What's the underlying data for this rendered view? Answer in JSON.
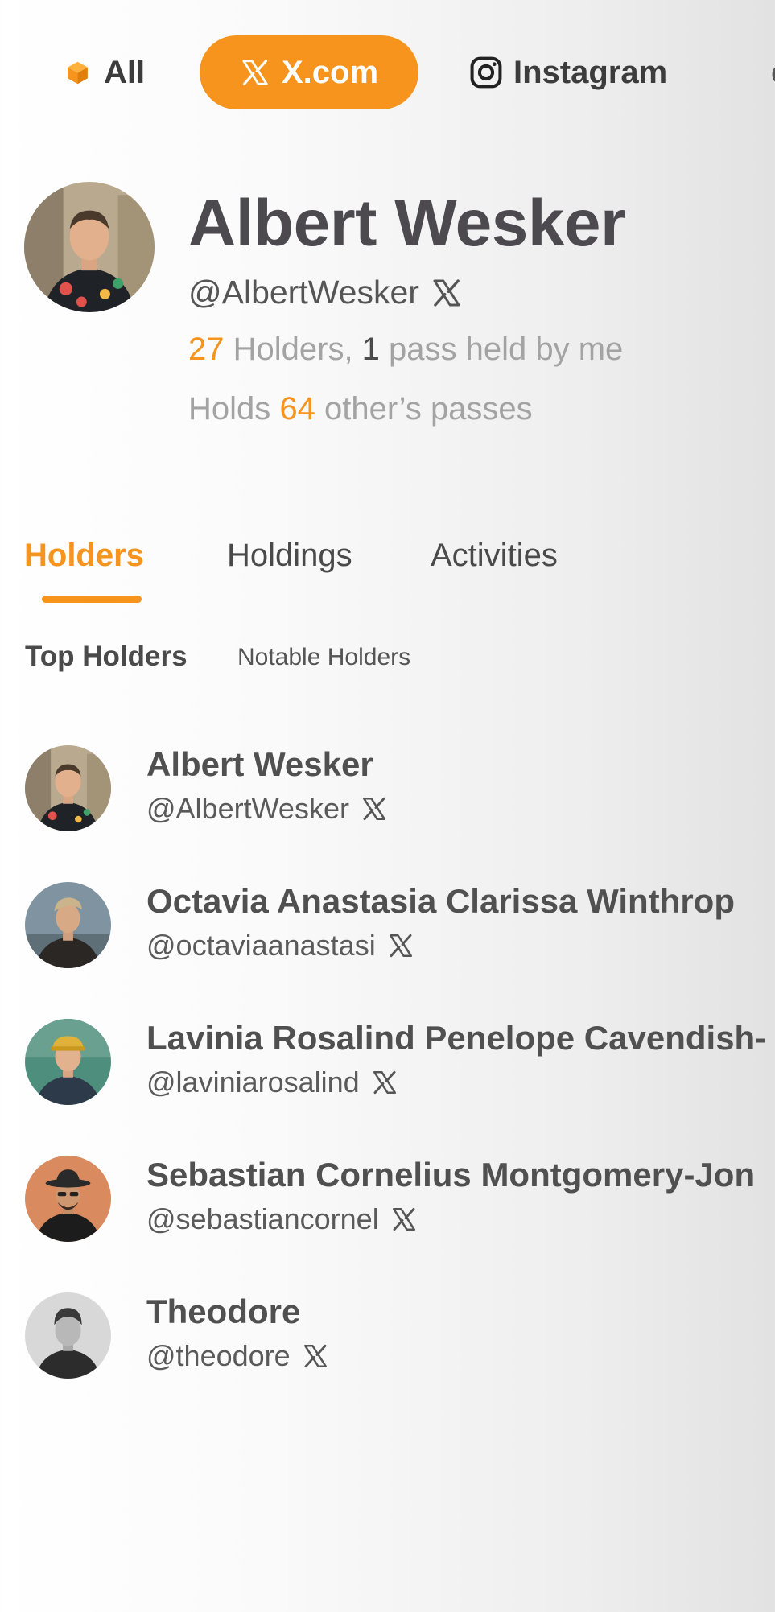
{
  "platform_tabs": {
    "all_label": "All",
    "x_label": "X.com",
    "instagram_label": "Instagram",
    "more_label": "c"
  },
  "profile": {
    "name": "Albert Wesker",
    "handle": "@AlbertWesker",
    "holders_count": "27",
    "holders_text": " Holders, ",
    "passes_held_by_me": "1",
    "passes_held_text": " pass held by me",
    "holds_prefix": "Holds ",
    "holds_count": "64",
    "holds_suffix": " other’s passes"
  },
  "tabs": [
    "Holders",
    "Holdings",
    "Activities"
  ],
  "subtabs": [
    "Top Holders",
    "Notable Holders"
  ],
  "holders": [
    {
      "name": "Albert Wesker",
      "handle": "@AlbertWesker"
    },
    {
      "name": "Octavia Anastasia Clarissa Winthrop",
      "handle": "@octaviaanastasi"
    },
    {
      "name": "Lavinia Rosalind Penelope Cavendish-",
      "handle": "@laviniarosalind"
    },
    {
      "name": "Sebastian Cornelius Montgomery-Jon",
      "handle": "@sebastiancornel"
    },
    {
      "name": "Theodore",
      "handle": "@theodore"
    }
  ],
  "colors": {
    "accent": "#f7941d",
    "text": "#4a4a4a",
    "muted": "#a3a3a3"
  }
}
